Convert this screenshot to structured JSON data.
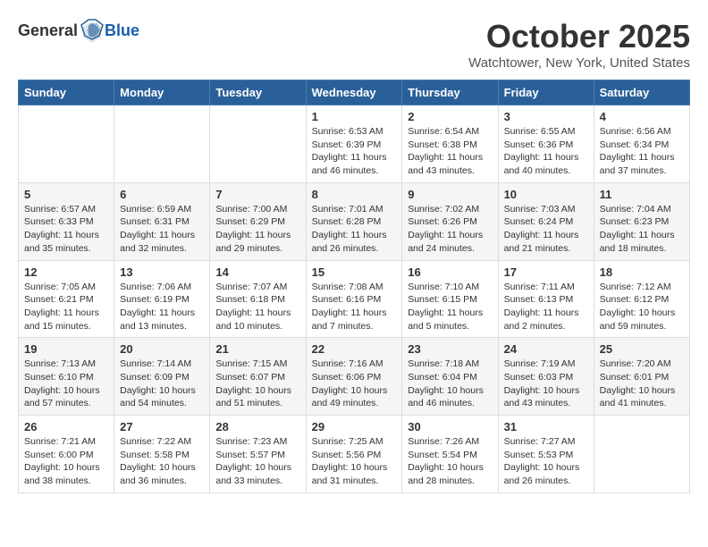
{
  "header": {
    "logo_general": "General",
    "logo_blue": "Blue",
    "title": "October 2025",
    "location": "Watchtower, New York, United States"
  },
  "weekdays": [
    "Sunday",
    "Monday",
    "Tuesday",
    "Wednesday",
    "Thursday",
    "Friday",
    "Saturday"
  ],
  "weeks": [
    [
      {
        "day": "",
        "info": ""
      },
      {
        "day": "",
        "info": ""
      },
      {
        "day": "",
        "info": ""
      },
      {
        "day": "1",
        "info": "Sunrise: 6:53 AM\nSunset: 6:39 PM\nDaylight: 11 hours\nand 46 minutes."
      },
      {
        "day": "2",
        "info": "Sunrise: 6:54 AM\nSunset: 6:38 PM\nDaylight: 11 hours\nand 43 minutes."
      },
      {
        "day": "3",
        "info": "Sunrise: 6:55 AM\nSunset: 6:36 PM\nDaylight: 11 hours\nand 40 minutes."
      },
      {
        "day": "4",
        "info": "Sunrise: 6:56 AM\nSunset: 6:34 PM\nDaylight: 11 hours\nand 37 minutes."
      }
    ],
    [
      {
        "day": "5",
        "info": "Sunrise: 6:57 AM\nSunset: 6:33 PM\nDaylight: 11 hours\nand 35 minutes."
      },
      {
        "day": "6",
        "info": "Sunrise: 6:59 AM\nSunset: 6:31 PM\nDaylight: 11 hours\nand 32 minutes."
      },
      {
        "day": "7",
        "info": "Sunrise: 7:00 AM\nSunset: 6:29 PM\nDaylight: 11 hours\nand 29 minutes."
      },
      {
        "day": "8",
        "info": "Sunrise: 7:01 AM\nSunset: 6:28 PM\nDaylight: 11 hours\nand 26 minutes."
      },
      {
        "day": "9",
        "info": "Sunrise: 7:02 AM\nSunset: 6:26 PM\nDaylight: 11 hours\nand 24 minutes."
      },
      {
        "day": "10",
        "info": "Sunrise: 7:03 AM\nSunset: 6:24 PM\nDaylight: 11 hours\nand 21 minutes."
      },
      {
        "day": "11",
        "info": "Sunrise: 7:04 AM\nSunset: 6:23 PM\nDaylight: 11 hours\nand 18 minutes."
      }
    ],
    [
      {
        "day": "12",
        "info": "Sunrise: 7:05 AM\nSunset: 6:21 PM\nDaylight: 11 hours\nand 15 minutes."
      },
      {
        "day": "13",
        "info": "Sunrise: 7:06 AM\nSunset: 6:19 PM\nDaylight: 11 hours\nand 13 minutes."
      },
      {
        "day": "14",
        "info": "Sunrise: 7:07 AM\nSunset: 6:18 PM\nDaylight: 11 hours\nand 10 minutes."
      },
      {
        "day": "15",
        "info": "Sunrise: 7:08 AM\nSunset: 6:16 PM\nDaylight: 11 hours\nand 7 minutes."
      },
      {
        "day": "16",
        "info": "Sunrise: 7:10 AM\nSunset: 6:15 PM\nDaylight: 11 hours\nand 5 minutes."
      },
      {
        "day": "17",
        "info": "Sunrise: 7:11 AM\nSunset: 6:13 PM\nDaylight: 11 hours\nand 2 minutes."
      },
      {
        "day": "18",
        "info": "Sunrise: 7:12 AM\nSunset: 6:12 PM\nDaylight: 10 hours\nand 59 minutes."
      }
    ],
    [
      {
        "day": "19",
        "info": "Sunrise: 7:13 AM\nSunset: 6:10 PM\nDaylight: 10 hours\nand 57 minutes."
      },
      {
        "day": "20",
        "info": "Sunrise: 7:14 AM\nSunset: 6:09 PM\nDaylight: 10 hours\nand 54 minutes."
      },
      {
        "day": "21",
        "info": "Sunrise: 7:15 AM\nSunset: 6:07 PM\nDaylight: 10 hours\nand 51 minutes."
      },
      {
        "day": "22",
        "info": "Sunrise: 7:16 AM\nSunset: 6:06 PM\nDaylight: 10 hours\nand 49 minutes."
      },
      {
        "day": "23",
        "info": "Sunrise: 7:18 AM\nSunset: 6:04 PM\nDaylight: 10 hours\nand 46 minutes."
      },
      {
        "day": "24",
        "info": "Sunrise: 7:19 AM\nSunset: 6:03 PM\nDaylight: 10 hours\nand 43 minutes."
      },
      {
        "day": "25",
        "info": "Sunrise: 7:20 AM\nSunset: 6:01 PM\nDaylight: 10 hours\nand 41 minutes."
      }
    ],
    [
      {
        "day": "26",
        "info": "Sunrise: 7:21 AM\nSunset: 6:00 PM\nDaylight: 10 hours\nand 38 minutes."
      },
      {
        "day": "27",
        "info": "Sunrise: 7:22 AM\nSunset: 5:58 PM\nDaylight: 10 hours\nand 36 minutes."
      },
      {
        "day": "28",
        "info": "Sunrise: 7:23 AM\nSunset: 5:57 PM\nDaylight: 10 hours\nand 33 minutes."
      },
      {
        "day": "29",
        "info": "Sunrise: 7:25 AM\nSunset: 5:56 PM\nDaylight: 10 hours\nand 31 minutes."
      },
      {
        "day": "30",
        "info": "Sunrise: 7:26 AM\nSunset: 5:54 PM\nDaylight: 10 hours\nand 28 minutes."
      },
      {
        "day": "31",
        "info": "Sunrise: 7:27 AM\nSunset: 5:53 PM\nDaylight: 10 hours\nand 26 minutes."
      },
      {
        "day": "",
        "info": ""
      }
    ]
  ]
}
